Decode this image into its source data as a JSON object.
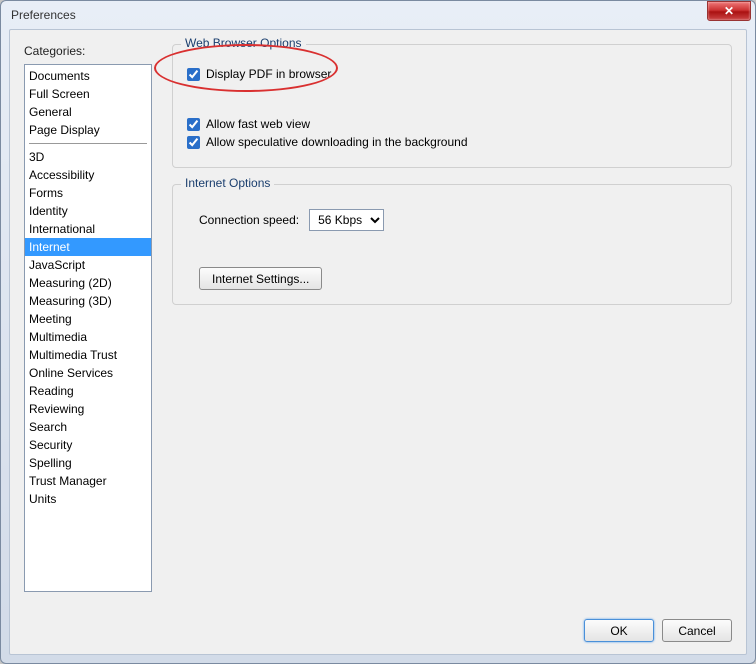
{
  "window": {
    "title": "Preferences"
  },
  "sidebar": {
    "label": "Categories:",
    "group1": [
      "Documents",
      "Full Screen",
      "General",
      "Page Display"
    ],
    "group2": [
      "3D",
      "Accessibility",
      "Forms",
      "Identity",
      "International",
      "Internet",
      "JavaScript",
      "Measuring (2D)",
      "Measuring (3D)",
      "Meeting",
      "Multimedia",
      "Multimedia Trust",
      "Online Services",
      "Reading",
      "Reviewing",
      "Search",
      "Security",
      "Spelling",
      "Trust Manager",
      "Units"
    ],
    "selected": "Internet"
  },
  "web_browser": {
    "title": "Web Browser Options",
    "display_pdf": {
      "label": "Display PDF in browser",
      "checked": true
    },
    "fast_web": {
      "label": "Allow fast web view",
      "checked": true
    },
    "speculative": {
      "label": "Allow speculative downloading in the background",
      "checked": true
    }
  },
  "internet_options": {
    "title": "Internet Options",
    "speed_label": "Connection speed:",
    "speed_value": "56 Kbps",
    "settings_button": "Internet Settings..."
  },
  "buttons": {
    "ok": "OK",
    "cancel": "Cancel"
  }
}
